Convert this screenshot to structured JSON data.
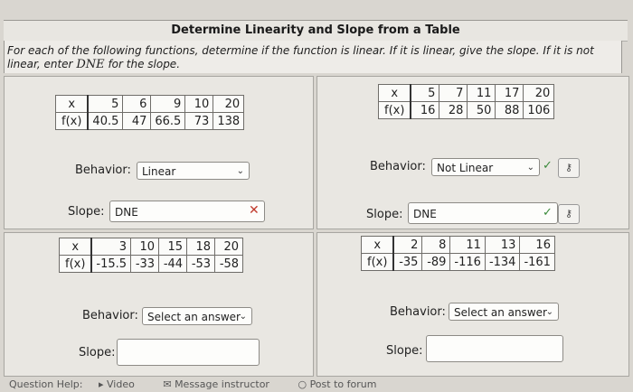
{
  "header": {
    "title": "Determine Linearity and Slope from a Table",
    "instructions_part1": "For each of the following functions, determine if the function is linear. If it is linear, give the slope. If it is not linear, enter",
    "instructions_dne": "DNE",
    "instructions_part2": "for the slope."
  },
  "problems": [
    {
      "row_labels": [
        "x",
        "f(x)"
      ],
      "x": [
        "5",
        "6",
        "9",
        "10",
        "20"
      ],
      "fx": [
        "40.5",
        "47",
        "66.5",
        "73",
        "138"
      ],
      "behavior_label": "Behavior:",
      "behavior_value": "Linear",
      "slope_label": "Slope:",
      "slope_value": "DNE",
      "status": "incorrect"
    },
    {
      "row_labels": [
        "x",
        "f(x)"
      ],
      "x": [
        "5",
        "7",
        "11",
        "17",
        "20"
      ],
      "fx": [
        "16",
        "28",
        "50",
        "88",
        "106"
      ],
      "behavior_label": "Behavior:",
      "behavior_value": "Not Linear",
      "slope_label": "Slope:",
      "slope_value": "DNE",
      "status": "correct"
    },
    {
      "row_labels": [
        "x",
        "f(x)"
      ],
      "x": [
        "3",
        "10",
        "15",
        "18",
        "20"
      ],
      "fx": [
        "-15.5",
        "-33",
        "-44",
        "-53",
        "-58"
      ],
      "behavior_label": "Behavior:",
      "behavior_value": "Select an answer",
      "slope_label": "Slope:",
      "slope_value": ""
    },
    {
      "row_labels": [
        "x",
        "f(x)"
      ],
      "x": [
        "2",
        "8",
        "11",
        "13",
        "16"
      ],
      "fx": [
        "-35",
        "-89",
        "-116",
        "-134",
        "-161"
      ],
      "behavior_label": "Behavior:",
      "behavior_value": "Select an answer",
      "slope_label": "Slope:",
      "slope_value": ""
    }
  ],
  "footer": {
    "help": "Question Help:",
    "video": "Video",
    "message": "Message instructor",
    "post": "Post to forum"
  },
  "icons": {
    "chevron": "chevron-down-icon",
    "check": "check-icon",
    "x": "close-icon",
    "key": "key-icon"
  }
}
